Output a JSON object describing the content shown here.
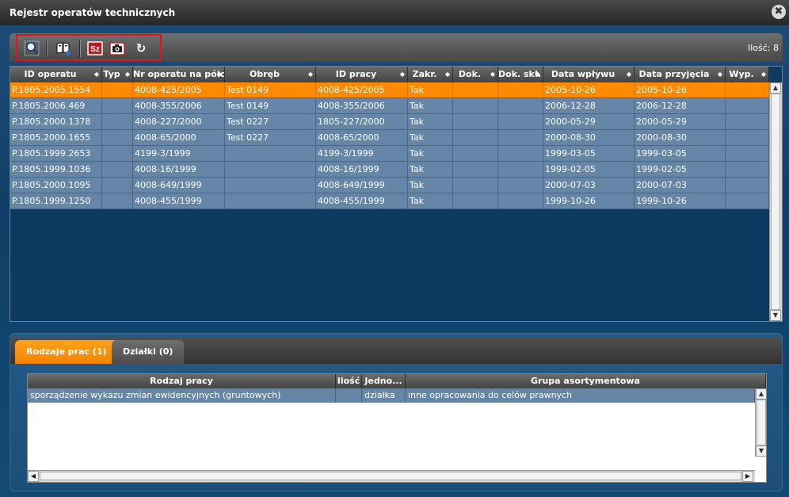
{
  "window": {
    "title": "Rejestr operatów technicznych",
    "close_glyph": "✖"
  },
  "toolbar": {
    "buttons": [
      {
        "name": "search-preview-button",
        "icon": "magnifier-icon"
      },
      {
        "name": "open-book-button",
        "icon": "book-icon"
      },
      {
        "name": "sz-button",
        "icon": "sz-icon",
        "label": "Sz"
      },
      {
        "name": "camera-button",
        "icon": "camera-icon"
      },
      {
        "name": "refresh-button",
        "icon": "refresh-icon",
        "label": "↻"
      }
    ],
    "count_label": "Ilość: 8"
  },
  "grid": {
    "columns": [
      {
        "label": "ID operatu",
        "sort": "◆"
      },
      {
        "label": "Typ",
        "sort": "◆"
      },
      {
        "label": "Nr operatu na półce",
        "sort": "◆"
      },
      {
        "label": "Obręb",
        "sort": "◆"
      },
      {
        "label": "ID pracy",
        "sort": "◆"
      },
      {
        "label": "Zakr.",
        "sort": "◆"
      },
      {
        "label": "Dok.",
        "sort": "◆"
      },
      {
        "label": "Dok. skł.",
        "sort": "◆"
      },
      {
        "label": "Data wpływu",
        "sort": "◆"
      },
      {
        "label": "Data przyjęcia",
        "sort": "◆"
      },
      {
        "label": "Wyp.",
        "sort": "◆"
      }
    ],
    "rows": [
      [
        "P.1805.2005.1554",
        "",
        "4008-425/2005",
        "Test 0149",
        "4008-425/2005",
        "Tak",
        "",
        "",
        "2005-10-26",
        "2005-10-26",
        ""
      ],
      [
        "P.1805.2006.469",
        "",
        "4008-355/2006",
        "Test 0149",
        "4008-355/2006",
        "Tak",
        "",
        "",
        "2006-12-28",
        "2006-12-28",
        ""
      ],
      [
        "P.1805.2000.1378",
        "",
        "4008-227/2000",
        "Test 0227",
        "1805-227/2000",
        "Tak",
        "",
        "",
        "2000-05-29",
        "2000-05-29",
        ""
      ],
      [
        "P.1805.2000.1655",
        "",
        "4008-65/2000",
        "Test 0227",
        "4008-65/2000",
        "Tak",
        "",
        "",
        "2000-08-30",
        "2000-08-30",
        ""
      ],
      [
        "P.1805.1999.2653",
        "",
        "4199-3/1999",
        "",
        "4199-3/1999",
        "Tak",
        "",
        "",
        "1999-03-05",
        "1999-03-05",
        ""
      ],
      [
        "P.1805.1999.1036",
        "",
        "4008-16/1999",
        "",
        "4008-16/1999",
        "Tak",
        "",
        "",
        "1999-02-05",
        "1999-02-05",
        ""
      ],
      [
        "P.1805.2000.1095",
        "",
        "4008-649/1999",
        "",
        "4008-649/1999",
        "Tak",
        "",
        "",
        "2000-07-03",
        "2000-07-03",
        ""
      ],
      [
        "P.1805.1999.1250",
        "",
        "4008-455/1999",
        "",
        "4008-455/1999",
        "Tak",
        "",
        "",
        "1999-10-26",
        "1999-10-26",
        ""
      ]
    ],
    "selected_row": 0
  },
  "tabs": [
    {
      "label": "Rodzaje prac (1)",
      "active": true
    },
    {
      "label": "Działki (0)",
      "active": false
    }
  ],
  "subgrid": {
    "columns": [
      "Rodzaj pracy",
      "Ilość",
      "Jedno...",
      "Grupa asortymentowa"
    ],
    "rows": [
      [
        "sporządzenie wykazu zmian ewidencyjnych (gruntowych)",
        "",
        "działka",
        "inne opracowania do celów prawnych"
      ]
    ]
  },
  "scroll": {
    "up": "▲",
    "down": "▼",
    "left": "◀",
    "right": "▶"
  },
  "colors": {
    "selected_row": "#ff8a00",
    "row": "#6686a7",
    "active_tab": "#f28200",
    "highlight_border": "#e0141a"
  }
}
